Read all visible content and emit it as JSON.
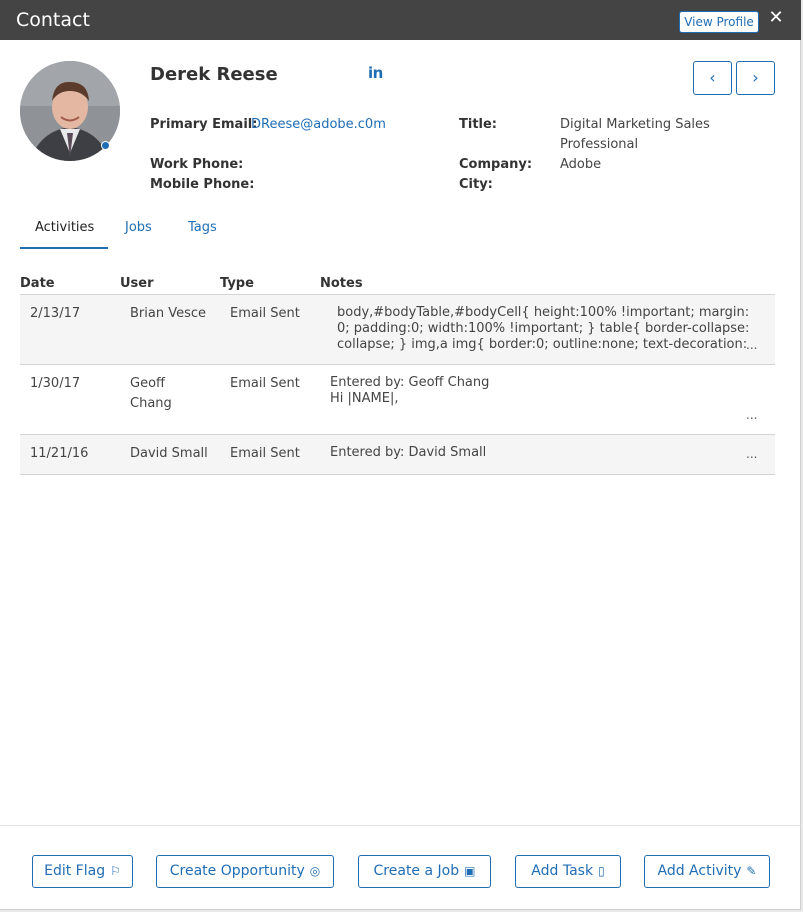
{
  "header": {
    "title": "Contact",
    "view_profile_label": "View Profile",
    "close_glyph": "✕"
  },
  "contact": {
    "name": "Derek Reese",
    "linkedin_label": "in",
    "primary_email_label": "Primary Email:",
    "primary_email": "DReese@adobe.c0m",
    "work_phone_label": "Work Phone:",
    "mobile_phone_label": "Mobile Phone:",
    "title_label": "Title:",
    "title_line1": "Digital Marketing Sales",
    "title_line2": "Professional",
    "company_label": "Company:",
    "company": "Adobe",
    "city_label": "City:"
  },
  "nav": {
    "prev_glyph": "‹",
    "next_glyph": "›"
  },
  "tabs": [
    {
      "label": "Activities",
      "active": true
    },
    {
      "label": "Jobs",
      "active": false
    },
    {
      "label": "Tags",
      "active": false
    }
  ],
  "table": {
    "columns": [
      "Date",
      "User",
      "Type",
      "Notes"
    ],
    "rows": [
      {
        "date": "2/13/17",
        "user": "Brian Vesce",
        "type": "Email Sent",
        "notes": "body,#bodyTable,#bodyCell{ height:100% !important; margin:0; padding:0; width:100% !important; } table{ border-collapse:collapse; } img,a img{ border:0; outline:none; text-decoration:none; }",
        "more": "..."
      },
      {
        "date": "1/30/17",
        "user_line1": "Geoff",
        "user_line2": "Chang",
        "type": "Email Sent",
        "notes_line1": "Entered by: Geoff Chang",
        "notes_line2": "Hi |NAME|,",
        "more": "..."
      },
      {
        "date": "11/21/16",
        "user": "David Small",
        "type": "Email Sent",
        "notes": "Entered by: David Small",
        "more": "..."
      }
    ]
  },
  "footer": {
    "edit_flag": "Edit Flag",
    "create_opportunity": "Create Opportunity",
    "create_job": "Create a Job",
    "add_task": "Add Task",
    "add_activity": "Add Activity"
  },
  "icons": {
    "flag": "⚐",
    "target": "◎",
    "briefcase": "▣",
    "clipboard": "▯",
    "pencil": "✎"
  },
  "colors": {
    "accent": "#1f6db4",
    "titlebar": "#444444"
  }
}
